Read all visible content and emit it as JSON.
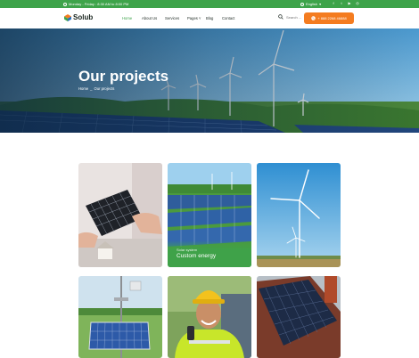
{
  "topbar": {
    "hours": "Monday - Friday : 8:30 AM to 8:00 PM",
    "language": "English",
    "socials": [
      {
        "icon": "facebook-icon",
        "glyph": "f"
      },
      {
        "icon": "twitter-icon",
        "glyph": "t"
      },
      {
        "icon": "youtube-icon",
        "glyph": "▶"
      },
      {
        "icon": "instagram-icon",
        "glyph": "◎"
      }
    ]
  },
  "header": {
    "logo": "Solub",
    "nav": {
      "home": "Home",
      "about": "About Us",
      "services": "Services",
      "pages": "Pages",
      "blog": "Blog",
      "contact": "Contact"
    },
    "search_placeholder": "Search ...",
    "cta_label": "+ 888 2268 46888"
  },
  "hero": {
    "title": "Our projects",
    "breadcrumb": {
      "home": "Home",
      "separator": "_",
      "current": "Our projects"
    }
  },
  "projects": [
    {
      "category": "",
      "title": ""
    },
    {
      "category": "Solar system",
      "title": "Custom energy"
    },
    {
      "category": "",
      "title": ""
    },
    {
      "category": "",
      "title": ""
    },
    {
      "category": "",
      "title": ""
    },
    {
      "category": "",
      "title": ""
    }
  ],
  "colors": {
    "brand_green": "#3ea34a",
    "accent_orange": "#f47c20",
    "text_dark": "#17231c"
  }
}
